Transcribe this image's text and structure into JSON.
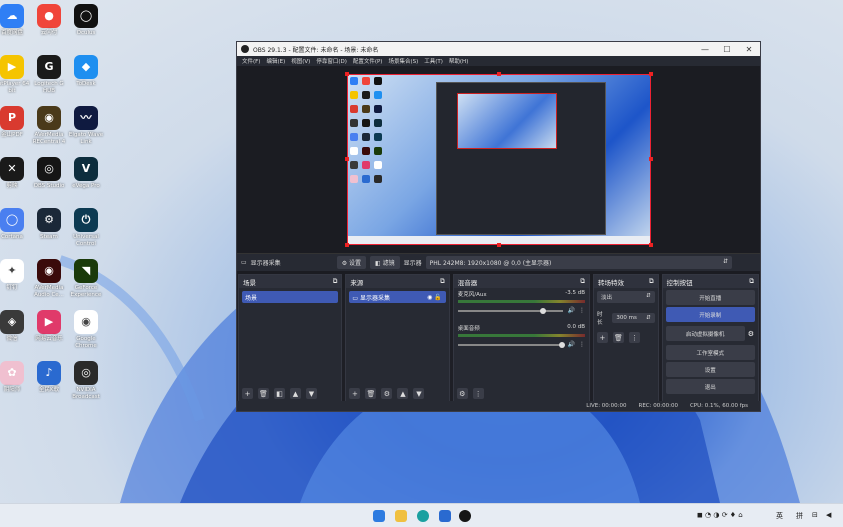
{
  "desktop": {
    "icons": [
      {
        "name": "baidu-netdisk-icon",
        "label": "百度网盘",
        "color": "#2f7ff5",
        "glyph": "☁"
      },
      {
        "name": "xiaohongshu-icon",
        "label": "云闪付",
        "color": "#f0453a",
        "glyph": "●"
      },
      {
        "name": "oculus-icon",
        "label": "Oculus",
        "color": "#111111",
        "glyph": "◯"
      },
      {
        "name": "potplayer-icon",
        "label": "PotPlayer 64 bit",
        "color": "#f5c400",
        "glyph": "▶"
      },
      {
        "name": "logitech-icon",
        "label": "Logitech G HUB",
        "color": "#1a1a1a",
        "glyph": "G"
      },
      {
        "name": "todesk-icon",
        "label": "ToDesk",
        "color": "#1e8ff0",
        "glyph": "◆"
      },
      {
        "name": "pdf-icon",
        "label": "金山PDF",
        "color": "#d93a2f",
        "glyph": "P"
      },
      {
        "name": "avermedia-icon",
        "label": "AVerMedia RECentral 4",
        "color": "#4a3a1a",
        "glyph": "◉"
      },
      {
        "name": "wave-icon",
        "label": "Elgato Wave Link",
        "color": "#0f1a40",
        "glyph": "〰"
      },
      {
        "name": "adobe-icon",
        "label": "剪映",
        "color": "#1a1a1a",
        "glyph": "✕"
      },
      {
        "name": "obs-icon",
        "label": "OBS Studio",
        "color": "#151515",
        "glyph": "◎"
      },
      {
        "name": "vegas-icon",
        "label": "eVega Pro",
        "color": "#0d2d3d",
        "glyph": "V"
      },
      {
        "name": "cortana-icon",
        "label": "Cortana",
        "color": "#4a7ff0",
        "glyph": "◯"
      },
      {
        "name": "steam-icon",
        "label": "Steam",
        "color": "#1b2838",
        "glyph": "⚙"
      },
      {
        "name": "universal-control-icon",
        "label": "Universal Control",
        "color": "#0c3a52",
        "glyph": "⏻"
      },
      {
        "name": "app-icon-a",
        "label": "钉钉",
        "color": "#ffffff",
        "glyph": "✦"
      },
      {
        "name": "avermedia-audio-icon",
        "label": "AVerMedia Audio Ce...",
        "color": "#3a0a0a",
        "glyph": "◉"
      },
      {
        "name": "geforce-icon",
        "label": "GeForce Experience",
        "color": "#1a3a0a",
        "glyph": "◥"
      },
      {
        "name": "wechat-icon",
        "label": "微信",
        "color": "#3a3a3a",
        "glyph": "◈"
      },
      {
        "name": "app-icon-b",
        "label": "网易云音乐",
        "color": "#e03a6a",
        "glyph": "▶"
      },
      {
        "name": "chrome-icon",
        "label": "Google Chrome",
        "color": "#ffffff",
        "glyph": "◉"
      },
      {
        "name": "anime-icon",
        "label": "阴阳师",
        "color": "#f0c0d0",
        "glyph": "✿"
      },
      {
        "name": "app-icon-c",
        "label": "全民K歌",
        "color": "#2a6ad0",
        "glyph": "♪"
      },
      {
        "name": "nvidia-icon",
        "label": "NVIDIA Broadcast",
        "color": "#2a2a2a",
        "glyph": "◎"
      }
    ]
  },
  "window": {
    "title": "OBS 29.1.3 - 配置文件: 未命名 - 场景: 未命名",
    "minimize": "—",
    "maximize": "☐",
    "close": "✕"
  },
  "menu": [
    "文件(F)",
    "编辑(E)",
    "视图(V)",
    "停靠窗口(D)",
    "配置文件(P)",
    "场景集合(S)",
    "工具(T)",
    "帮助(H)"
  ],
  "context_bar": {
    "source_name": "显示器采集",
    "properties": "设置",
    "filters": "滤镜",
    "display_label": "显示器",
    "display_value": "PHL 242M8: 1920x1080 @ 0,0 (主显示器)"
  },
  "docks": {
    "scenes": {
      "title": "场景",
      "items": [
        "场景"
      ]
    },
    "sources": {
      "title": "来源",
      "items": [
        "显示器采集"
      ]
    },
    "mixer": {
      "title": "混音器",
      "channels": [
        {
          "name": "麦克风/Aux",
          "db": "-3.5 dB",
          "level": 0.82
        },
        {
          "name": "桌面音频",
          "db": "0.0 dB",
          "level": 1.0
        }
      ]
    },
    "transitions": {
      "title": "转场特效",
      "selected": "淡出",
      "duration_label": "时长",
      "duration_value": "300 ms"
    },
    "controls": {
      "title": "控制按钮",
      "buttons": [
        "开始直播",
        "开始录制",
        "启动虚拟摄像机",
        "工作室模式",
        "设置",
        "退出"
      ]
    }
  },
  "status": {
    "live": "LIVE: 00:00:00",
    "rec": "REC: 00:00:00",
    "cpu": "CPU: 0.1%, 60.00 fps"
  },
  "tray": {
    "ime_lang": "英",
    "ime_mode": "拼"
  }
}
